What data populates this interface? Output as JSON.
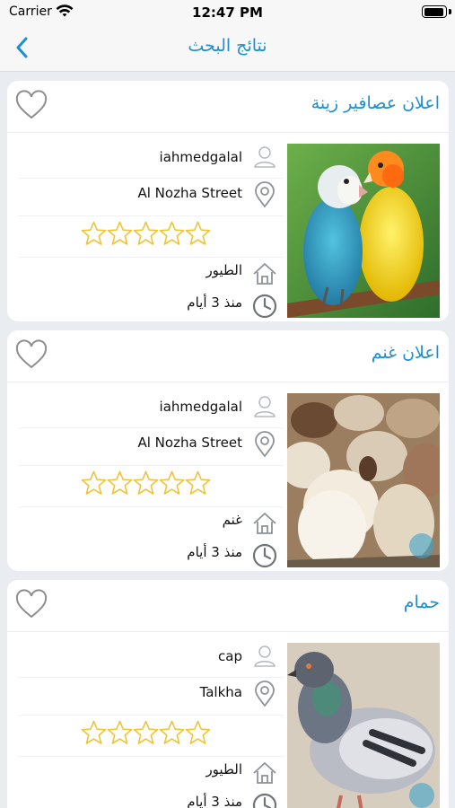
{
  "status_bar": {
    "carrier": "Carrier",
    "time": "12:47 PM",
    "battery_level": 0.95
  },
  "nav": {
    "title": "نتائج البحث",
    "back_icon": "chevron-left-icon"
  },
  "colors": {
    "accent": "#1f8fd0",
    "star": "#f1c232",
    "icon_gray": "#9aa0a6"
  },
  "listings": [
    {
      "title": "اعلان عصافير زينة",
      "user": "iahmedgalal",
      "location": "Al Nozha Street",
      "rating": 0,
      "category": "الطيور",
      "time_ago": "منذ 3 أيام",
      "photo": "lovebirds-photo"
    },
    {
      "title": "اعلان غنم",
      "user": "iahmedgalal",
      "location": "Al Nozha Street",
      "rating": 0,
      "category": "غنم",
      "time_ago": "منذ 3 أيام",
      "photo": "sheep-photo"
    },
    {
      "title": "حمام",
      "user": "cap",
      "location": "Talkha",
      "rating": 0,
      "category": "الطيور",
      "time_ago": "منذ 3 أيام",
      "photo": "pigeon-photo"
    }
  ]
}
